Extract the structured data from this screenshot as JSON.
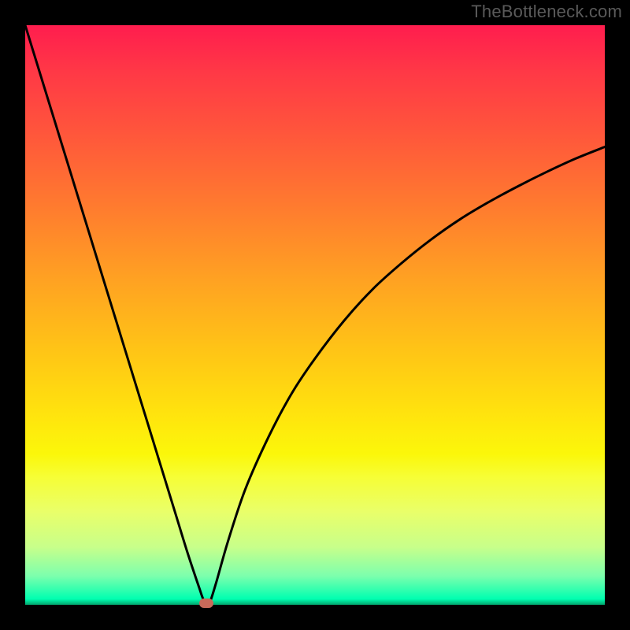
{
  "watermark": "TheBottleneck.com",
  "colors": {
    "frame_bg": "#000000",
    "gradient_top": "#ff1d4e",
    "gradient_bottom": "#02a56e",
    "curve_stroke": "#000000",
    "marker_fill": "#c86a5a"
  },
  "chart_data": {
    "type": "line",
    "title": "",
    "xlabel": "",
    "ylabel": "",
    "xlim": [
      0,
      100
    ],
    "ylim": [
      0,
      100
    ],
    "grid": false,
    "legend": false,
    "annotations": [],
    "series": [
      {
        "name": "curve",
        "x": [
          0,
          2,
          4,
          6,
          8,
          10,
          12,
          14,
          16,
          18,
          20,
          22,
          24,
          26,
          28,
          30,
          30.8,
          31.5,
          32,
          33,
          35,
          38,
          42,
          46,
          50,
          55,
          60,
          65,
          70,
          75,
          80,
          85,
          90,
          95,
          100
        ],
        "y": [
          100,
          93.5,
          87,
          80.5,
          74,
          67.5,
          61,
          54.5,
          48,
          41.5,
          35,
          28.5,
          22,
          15.5,
          9,
          3,
          0.8,
          0.2,
          0.8,
          4,
          11,
          20,
          29,
          36.5,
          42.5,
          49,
          54.5,
          59,
          63,
          66.5,
          69.5,
          72.2,
          74.7,
          77,
          79
        ]
      }
    ],
    "minimum_marker": {
      "x": 31.2,
      "y": 0.3
    },
    "background": "vertical-gradient"
  }
}
